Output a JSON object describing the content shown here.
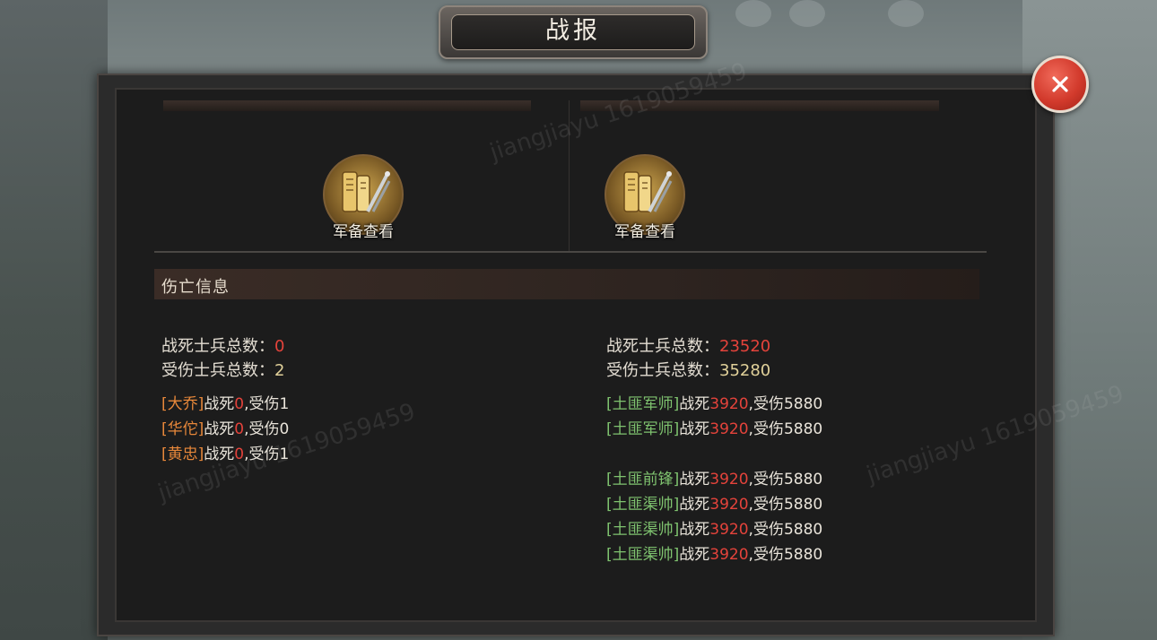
{
  "title": "战报",
  "army_view": {
    "left_label": "军备查看",
    "right_label": "军备查看"
  },
  "casualty": {
    "header": "伤亡信息",
    "left": {
      "dead_label": "战死士兵总数：",
      "dead_value": "0",
      "wounded_label": "受伤士兵总数：",
      "wounded_value": "2",
      "units": [
        {
          "name": "[大乔]",
          "dead_label": "战死",
          "dead": "0",
          "sep": ",",
          "wounded_label": "受伤",
          "wounded": "1"
        },
        {
          "name": "[华佗]",
          "dead_label": "战死",
          "dead": "0",
          "sep": ",",
          "wounded_label": "受伤",
          "wounded": "0"
        },
        {
          "name": "[黄忠]",
          "dead_label": "战死",
          "dead": "0",
          "sep": ",",
          "wounded_label": "受伤",
          "wounded": "1"
        }
      ]
    },
    "right": {
      "dead_label": "战死士兵总数：",
      "dead_value": "23520",
      "wounded_label": "受伤士兵总数：",
      "wounded_value": "35280",
      "units": [
        {
          "name": "[土匪军师]",
          "dead_label": "战死",
          "dead": "3920",
          "sep": ",",
          "wounded_label": "受伤",
          "wounded": "5880"
        },
        {
          "name": "[土匪军师]",
          "dead_label": "战死",
          "dead": "3920",
          "sep": ",",
          "wounded_label": "受伤",
          "wounded": "5880"
        },
        {
          "name": "[土匪前锋]",
          "dead_label": "战死",
          "dead": "3920",
          "sep": ",",
          "wounded_label": "受伤",
          "wounded": "5880"
        },
        {
          "name": "[土匪渠帅]",
          "dead_label": "战死",
          "dead": "3920",
          "sep": ",",
          "wounded_label": "受伤",
          "wounded": "5880"
        },
        {
          "name": "[土匪渠帅]",
          "dead_label": "战死",
          "dead": "3920",
          "sep": ",",
          "wounded_label": "受伤",
          "wounded": "5880"
        },
        {
          "name": "[土匪渠帅]",
          "dead_label": "战死",
          "dead": "3920",
          "sep": ",",
          "wounded_label": "受伤",
          "wounded": "5880"
        }
      ]
    }
  },
  "watermarks": [
    "jiangjiayu 1619059459",
    "jiangjiayu 1619059459",
    "jiangjiayu 1619059459"
  ],
  "colors": {
    "dead": "#e4433b",
    "wounded_total": "#e1d19a",
    "ally_name": "#e8883a",
    "enemy_name": "#7fc36f",
    "close_button": "#d23a2c"
  },
  "icons": {
    "close": "close-icon",
    "army": "scroll-weapons-icon"
  }
}
